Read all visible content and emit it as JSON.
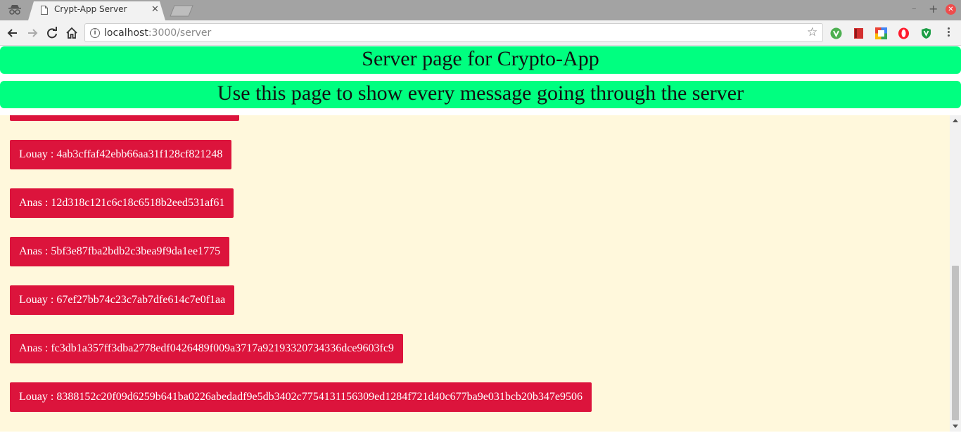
{
  "browser": {
    "tab_title": "Crypt-App Server",
    "tab_close": "✕",
    "url_host": "localhost",
    "url_path": ":3000/server",
    "window_min": "–",
    "window_max": "+",
    "window_close": "✕",
    "info_glyph": "i",
    "bookmark_glyph": "☆",
    "extensions": [
      {
        "name": "vpn-shield-icon",
        "color": "#4caf50"
      },
      {
        "name": "red-book-icon",
        "color": "#d32f2f"
      },
      {
        "name": "google-icon",
        "color": "#4285f4"
      },
      {
        "name": "opera-icon",
        "color": "#ff1b2d"
      },
      {
        "name": "green-shield-icon",
        "color": "#1b9e45"
      }
    ]
  },
  "page": {
    "title": "Server page for Crypto-App",
    "subtitle": "Use this page to show every message going through the server",
    "colors": {
      "banner": "#00ff80",
      "background": "#fff8dc",
      "message": "#dc143c"
    }
  },
  "messages": [
    "Louay : 4ab3cffaf42ebb66aa31f128cf821248",
    "Anas : 12d318c121c6c18c6518b2eed531af61",
    "Anas : 5bf3e87fba2bdb2c3bea9f9da1ee1775",
    "Louay : 67ef27bb74c23c7ab7dfe614c7e0f1aa",
    "Anas : fc3db1a357ff3dba2778edf0426489f009a3717a92193320734336dce9603fc9",
    "Louay : 8388152c20f09d6259b641ba0226abedadf9e5db3402c7754131156309ed1284f721d40c677ba9e031bcb20b347e9506"
  ]
}
